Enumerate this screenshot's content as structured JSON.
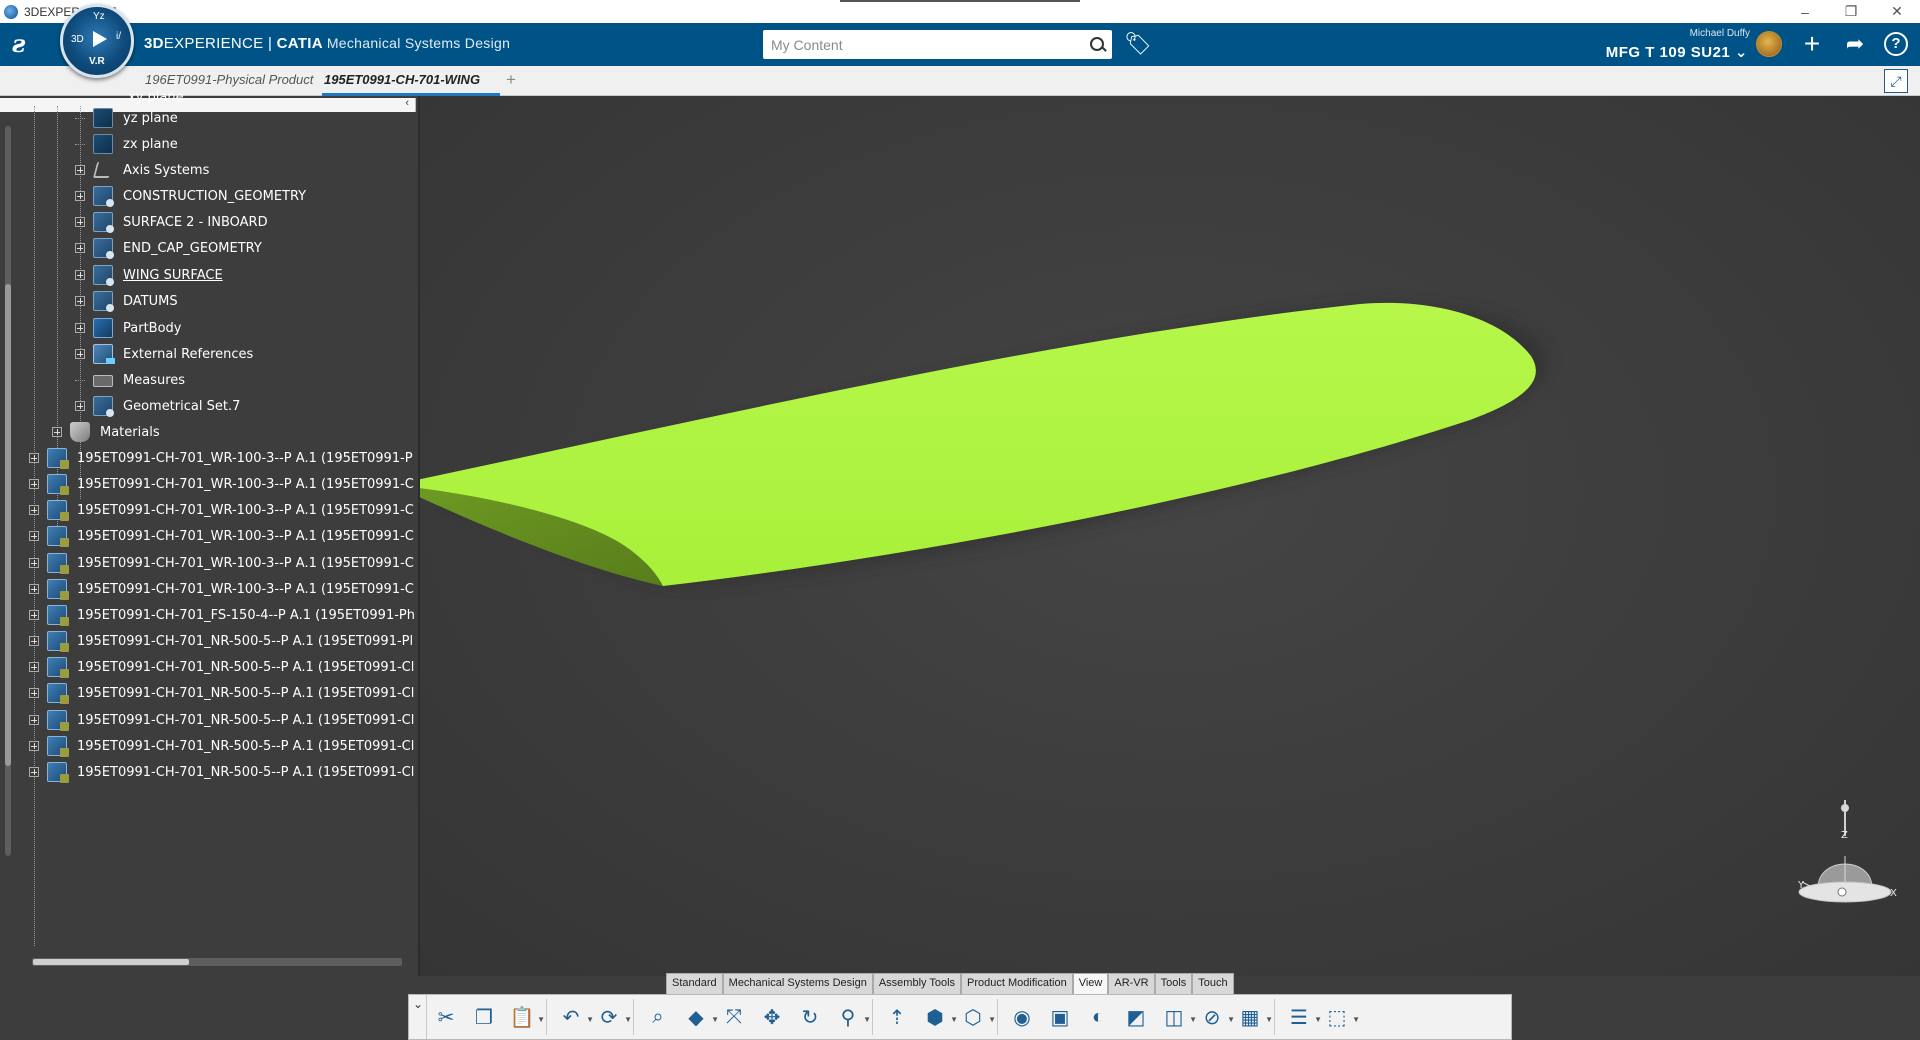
{
  "os_window": {
    "title": "3DEXPERIENCE",
    "controls": [
      "–",
      "❐",
      "✕"
    ]
  },
  "header": {
    "brand_bold": "3D",
    "brand_rest": "EXPERIENCE | ",
    "brand_catia": "CATIA",
    "app_name": "Mechanical Systems Design",
    "compass": {
      "n": "Yz",
      "w": "3D",
      "e": "i/",
      "s": "V.R"
    },
    "search_placeholder": "My Content",
    "user_name": "Michael Duffy",
    "tenant": "MFG T 109 SU21 ⌄"
  },
  "tabs": {
    "tab1": "196ET0991-Physical Product",
    "tab2": "195ET0991-CH-701-WING",
    "add": "+"
  },
  "tree": {
    "partial_top": "xy plane",
    "items": [
      {
        "label": "yz plane",
        "icon": "plane-icon",
        "expandable": false
      },
      {
        "label": "zx plane",
        "icon": "plane-icon",
        "expandable": false
      },
      {
        "label": "Axis Systems",
        "icon": "axis-system-icon",
        "expandable": true
      },
      {
        "label": "CONSTRUCTION_GEOMETRY",
        "icon": "geometrical-set-icon",
        "expandable": true
      },
      {
        "label": "SURFACE 2 - INBOARD",
        "icon": "geometrical-set-icon",
        "expandable": true
      },
      {
        "label": "END_CAP_GEOMETRY",
        "icon": "geometrical-set-icon",
        "expandable": true
      },
      {
        "label": "WING SURFACE",
        "icon": "geometrical-set-icon",
        "expandable": true
      },
      {
        "label": "DATUMS",
        "icon": "geometrical-set-icon",
        "expandable": true
      },
      {
        "label": "PartBody",
        "icon": "part-body-icon",
        "expandable": true
      },
      {
        "label": "External References",
        "icon": "external-references-icon",
        "expandable": true
      },
      {
        "label": "Measures",
        "icon": "measure-icon",
        "expandable": false
      },
      {
        "label": "Geometrical Set.7",
        "icon": "geometrical-set-icon",
        "expandable": true
      }
    ],
    "materials": "Materials",
    "parts": [
      "195ET0991-CH-701_WR-100-3--P A.1 (195ET0991-P",
      "195ET0991-CH-701_WR-100-3--P A.1 (195ET0991-C",
      "195ET0991-CH-701_WR-100-3--P A.1 (195ET0991-C",
      "195ET0991-CH-701_WR-100-3--P A.1 (195ET0991-C",
      "195ET0991-CH-701_WR-100-3--P A.1 (195ET0991-C",
      "195ET0991-CH-701_WR-100-3--P A.1 (195ET0991-C",
      "195ET0991-CH-701_FS-150-4--P A.1 (195ET0991-Ph",
      "195ET0991-CH-701_NR-500-5--P A.1 (195ET0991-Pl",
      "195ET0991-CH-701_NR-500-5--P A.1 (195ET0991-Cl",
      "195ET0991-CH-701_NR-500-5--P A.1 (195ET0991-Cl",
      "195ET0991-CH-701_NR-500-5--P A.1 (195ET0991-Cl",
      "195ET0991-CH-701_NR-500-5--P A.1 (195ET0991-Cl",
      "195ET0991-CH-701_NR-500-5--P A.1 (195ET0991-Cl"
    ]
  },
  "viewport": {
    "wing_color": "#a8f03a",
    "compass_axes": {
      "x": "X",
      "y": "Y",
      "z": "Z"
    }
  },
  "action_bar": {
    "section_tabs": [
      "Standard",
      "Mechanical Systems Design",
      "Assembly Tools",
      "Product Modification",
      "View",
      "AR-VR",
      "Tools",
      "Touch"
    ],
    "active_section": "View",
    "tools": [
      {
        "name": "cut-icon",
        "glyph": "✂"
      },
      {
        "name": "copy-icon",
        "glyph": "❐"
      },
      {
        "name": "paste-icon",
        "glyph": "📋"
      },
      {
        "name": "undo-icon",
        "glyph": "↶"
      },
      {
        "name": "update-icon",
        "glyph": "⟳"
      },
      {
        "name": "zoom-icon",
        "glyph": "⌕"
      },
      {
        "name": "view-cube-icon",
        "glyph": "◆"
      },
      {
        "name": "fit-all-icon",
        "glyph": "⤧"
      },
      {
        "name": "pan-icon",
        "glyph": "✥"
      },
      {
        "name": "rotate-icon",
        "glyph": "↻"
      },
      {
        "name": "zoom-in-out-icon",
        "glyph": "⚲"
      },
      {
        "name": "normal-view-icon",
        "glyph": "⇡"
      },
      {
        "name": "iso-view-icon",
        "glyph": "⬢"
      },
      {
        "name": "render-style-icon",
        "glyph": "⬡"
      },
      {
        "name": "lighting-icon",
        "glyph": "◉"
      },
      {
        "name": "capture-icon",
        "glyph": "▣"
      },
      {
        "name": "hide-show-icon",
        "glyph": "◐"
      },
      {
        "name": "swap-visible-icon",
        "glyph": "◩"
      },
      {
        "name": "camera-icon",
        "glyph": "◫"
      },
      {
        "name": "measure-tool-icon",
        "glyph": "⊘"
      },
      {
        "name": "split-view-icon",
        "glyph": "▦"
      },
      {
        "name": "specification-tree-icon",
        "glyph": "☰"
      },
      {
        "name": "compass-tool-icon",
        "glyph": "⬚"
      }
    ]
  }
}
